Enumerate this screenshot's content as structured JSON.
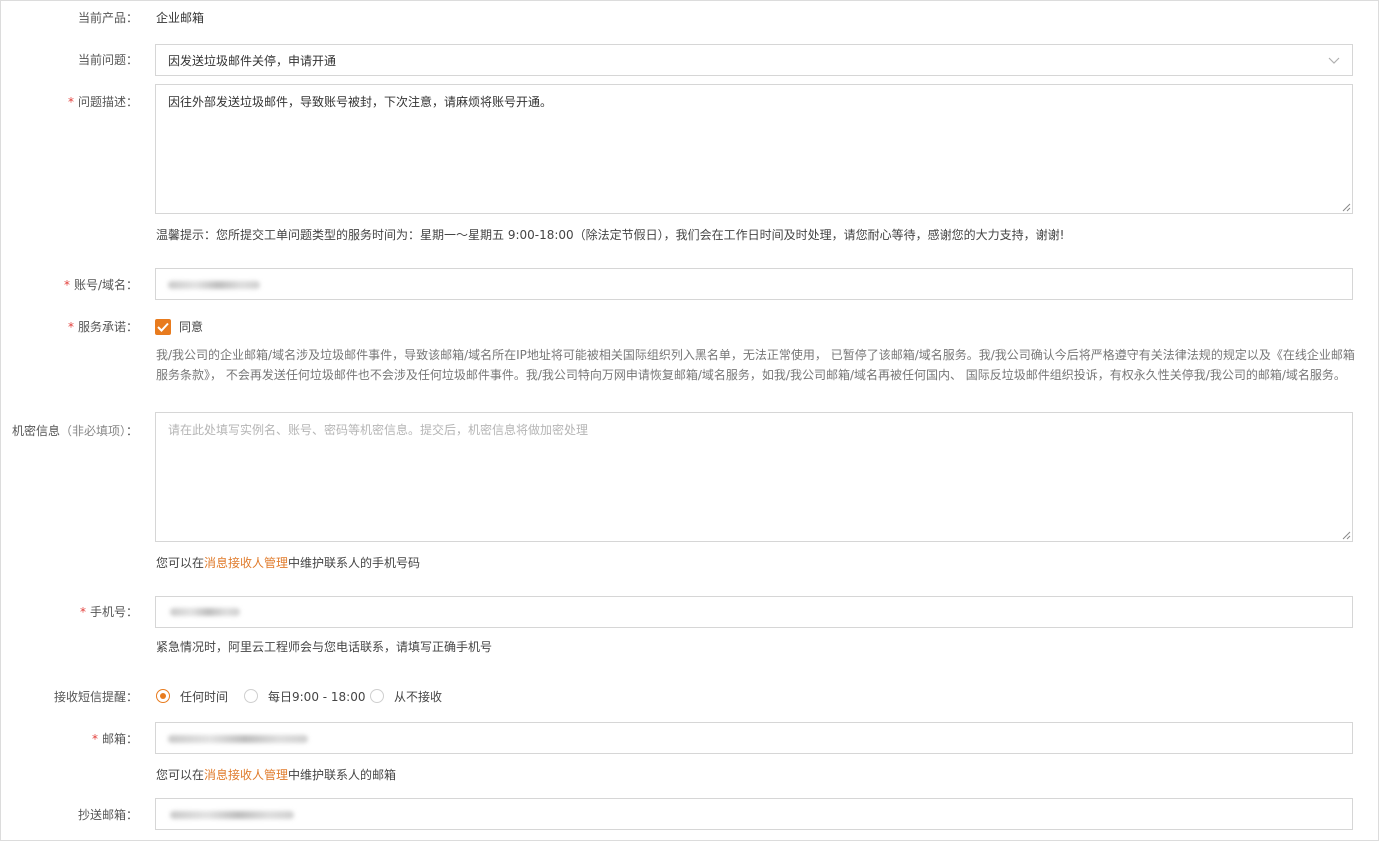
{
  "product": {
    "label": "当前产品：",
    "value": "企业邮箱"
  },
  "issue": {
    "label": "当前问题：",
    "value": "因发送垃圾邮件关停，申请开通"
  },
  "description": {
    "required_mark": "*",
    "label": "问题描述：",
    "value": "因往外部发送垃圾邮件，导致账号被封，下次注意，请麻烦将账号开通。"
  },
  "service_hours_note": "温馨提示：您所提交工单问题类型的服务时间为：星期一～星期五 9:00-18:00（除法定节假日），我们会在工作日时间及时处理，请您耐心等待，感谢您的大力支持，谢谢!",
  "account": {
    "required_mark": "*",
    "label": "账号/域名："
  },
  "commitment": {
    "required_mark": "*",
    "label": "服务承诺：",
    "checkbox_label": "同意",
    "checked": true,
    "terms": "我/我公司的企业邮箱/域名涉及垃圾邮件事件，导致该邮箱/域名所在IP地址将可能被相关国际组织列入黑名单，无法正常使用， 已暂停了该邮箱/域名服务。我/我公司确认今后将严格遵守有关法律法规的规定以及《在线企业邮箱服务条款》， 不会再发送任何垃圾邮件也不会涉及任何垃圾邮件事件。我/我公司特向万网申请恢复邮箱/域名服务，如我/我公司邮箱/域名再被任何国内、 国际反垃圾邮件组织投诉，有权永久性关停我/我公司的邮箱/域名服务。"
  },
  "confidential": {
    "label": "机密信息",
    "optional_hint": "（非必填项）",
    "colon": "：",
    "placeholder": "请在此处填写实例名、账号、密码等机密信息。提交后，机密信息将做加密处理"
  },
  "contact_phone_note": {
    "prefix": "您可以在",
    "link": "消息接收人管理",
    "suffix": "中维护联系人的手机号码"
  },
  "phone": {
    "required_mark": "*",
    "label": "手机号："
  },
  "phone_note": "紧急情况时，阿里云工程师会与您电话联系，请填写正确手机号",
  "sms": {
    "label": "接收短信提醒：",
    "options": [
      "任何时间",
      "每日9:00 - 18:00",
      "从不接收"
    ],
    "selected_index": 0
  },
  "email": {
    "required_mark": "*",
    "label": "邮箱："
  },
  "contact_email_note": {
    "prefix": "您可以在",
    "link": "消息接收人管理",
    "suffix": "中维护联系人的邮箱"
  },
  "cc_email": {
    "label": "抄送邮箱："
  },
  "colors": {
    "accent": "#e87b1e",
    "required": "#e3403c",
    "link": "#e07b2b"
  },
  "icons": {
    "select_arrow": "chevron-down-icon",
    "checkbox": "check-icon",
    "textarea_grip": "resize-grip-icon"
  }
}
